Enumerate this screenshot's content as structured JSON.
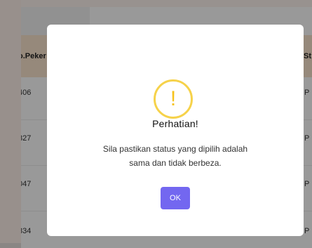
{
  "table": {
    "headers": {
      "left": "o.Peker",
      "right": "St"
    },
    "rows": [
      {
        "left": "406",
        "right": "P"
      },
      {
        "left": "327",
        "right": "P"
      },
      {
        "left": "047",
        "right": "P"
      },
      {
        "left": "334",
        "right": "P"
      }
    ]
  },
  "modal": {
    "icon_glyph": "!",
    "icon": "exclamation-circle-icon",
    "title": "Perhatian!",
    "message_line1": "Sila pastikan status yang dipilih adalah",
    "message_line2": "sama dan tidak berbeza.",
    "ok_label": "OK"
  },
  "colors": {
    "accent": "#7367f0",
    "warning": "#f6d24a",
    "header_bg": "#fbe4cd"
  }
}
